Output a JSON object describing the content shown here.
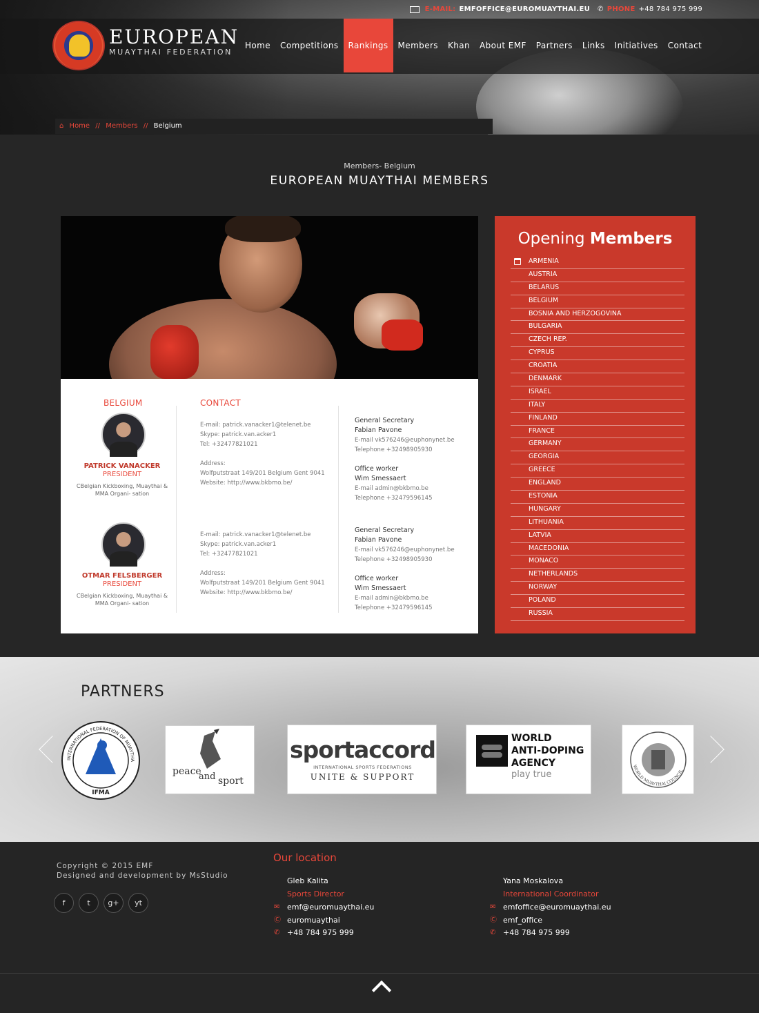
{
  "topbar": {
    "email_label": "E-MAIL:",
    "email": "EMFOFFICE@EUROMUAYTHAI.EU",
    "phone_label": "PHONE",
    "phone": "+48 784 975 999"
  },
  "brand": {
    "line1": "EUROPEAN",
    "line2": "MUAYTHAI FEDERATION"
  },
  "nav": [
    "Home",
    "Competitions",
    "Rankings",
    "Members",
    "Khan",
    "About EMF",
    "Partners",
    "Links",
    "Initiatives",
    "Contact"
  ],
  "nav_active": "Rankings",
  "breadcrumb": {
    "home": "Home",
    "sep": "//",
    "members": "Members",
    "current": "Belgium"
  },
  "page": {
    "subtitle": "Members- Belgium",
    "title": "EUROPEAN MUAYTHAI MEMBERS"
  },
  "card": {
    "country": "BELGIUM",
    "contact_heading": "CONTACT",
    "entries": [
      {
        "name": "PATRICK VANACKER",
        "role": "PRESIDENT",
        "org": "CBelgian Kickboxing, Muaythai & MMA Organi- sation",
        "email": "E-mail: patrick.vanacker1@telenet.be",
        "skype": "Skype: patrick.van.acker1",
        "tel": "Tel:  +32477821021",
        "address_label": "Address:",
        "address": "Wolfputstraat 149/201 Belgium Gent 9041",
        "website": "Website: http://www.bkbmo.be/",
        "gs_title": "General Secretary",
        "gs_name": "Fabian Pavone",
        "gs_email": "E-mail vk576246@euphonynet.be",
        "gs_tel": "Telephone     +32498905930",
        "ow_title": "Office worker",
        "ow_name": "Wim Smessaert",
        "ow_email": "E-mail admin@bkbmo.be",
        "ow_tel": "Telephone     +32479596145"
      },
      {
        "name": "OTMAR FELSBERGER",
        "role": "PRESIDENT",
        "org": "CBelgian Kickboxing, Muaythai & MMA Organi- sation",
        "email": "E-mail: patrick.vanacker1@telenet.be",
        "skype": "Skype: patrick.van.acker1",
        "tel": "Tel:  +32477821021",
        "address_label": "Address:",
        "address": "Wolfputstraat 149/201 Belgium Gent 9041",
        "website": "Website: http://www.bkbmo.be/",
        "gs_title": "General Secretary",
        "gs_name": "Fabian Pavone",
        "gs_email": "E-mail vk576246@euphonynet.be",
        "gs_tel": "Telephone     +32498905930",
        "ow_title": "Office worker",
        "ow_name": "Wim Smessaert",
        "ow_email": "E-mail admin@bkbmo.be",
        "ow_tel": "Telephone     +32479596145"
      }
    ]
  },
  "sidebar": {
    "title_normal": "Opening",
    "title_bold": "Members",
    "countries": [
      "ARMENIA",
      "AUSTRIA",
      "BELARUS",
      "BELGIUM",
      "BOSNIA AND HERZOGOVINA",
      "BULGARIA",
      "CZECH REP.",
      "CYPRUS",
      "CROATIA",
      "DENMARK",
      "ISRAEL",
      "ITALY",
      "FINLAND",
      "FRANCE",
      "GERMANY",
      "GEORGIA",
      "GREECE",
      "ENGLAND",
      "ESTONIA",
      "HUNGARY",
      "LITHUANIA",
      "LATVIA",
      "MACEDONIA",
      "MONACO",
      "NETHERLANDS",
      "NORWAY",
      "POLAND",
      "RUSSIA"
    ]
  },
  "partners": {
    "title": "PARTNERS",
    "ifma_ring": "INTERNATIONAL FEDERATION OF MUAYTHAI AMATEUR",
    "ifma_label": "IFMA",
    "peace": "peace",
    "and": "and",
    "sport": "sport",
    "sportaccord": "sportaccord",
    "sportaccord_sub": "INTERNATIONAL SPORTS FEDERATIONS",
    "sportaccord_tag": "UNITE & SUPPORT",
    "wada_1": "WORLD",
    "wada_2": "ANTI-DOPING",
    "wada_3": "AGENCY",
    "wada_tag": "play true",
    "wmc_ring": "WORLD MUAYTHAI COUNCIL"
  },
  "footer": {
    "copyright": "Copyright © 2015 EMF",
    "designed": "Designed and development by MsStudio",
    "location_title": "Our location",
    "social": [
      "f",
      "t",
      "g+",
      "yt"
    ],
    "contacts": [
      {
        "name": "Gleb Kalita",
        "role": "Sports Director",
        "email": "emf@euromuaythai.eu",
        "skype": "euromuaythai",
        "phone": "+48 784 975 999"
      },
      {
        "name": "Yana Moskalova",
        "role": "International Coordinator",
        "email": "emfoffice@euromuaythai.eu",
        "skype": "emf_office",
        "phone": "+48 784 975 999"
      }
    ]
  }
}
